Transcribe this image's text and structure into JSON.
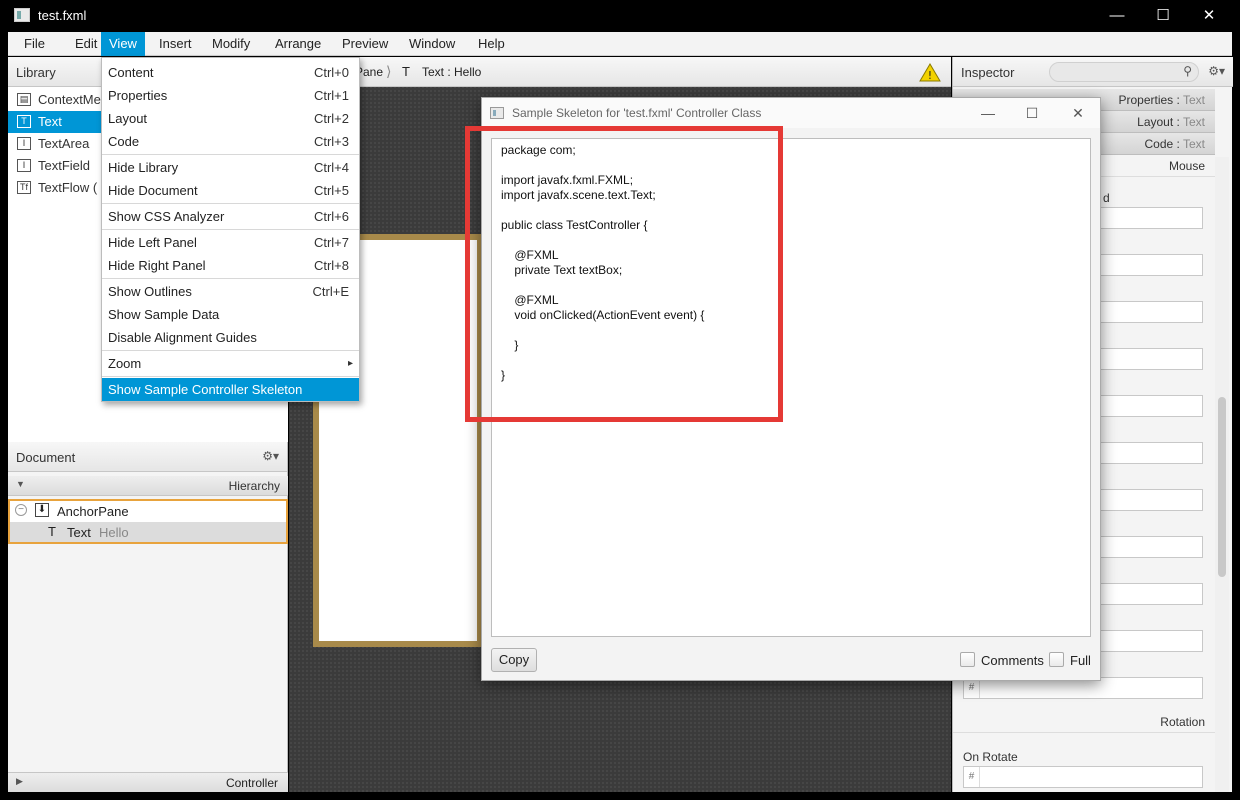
{
  "window": {
    "title": "test.fxml",
    "minimize_icon": "minimize-icon",
    "maximize_icon": "maximize-icon",
    "close_icon": "close-icon"
  },
  "menubar": {
    "items": [
      "File",
      "Edit",
      "View",
      "Insert",
      "Modify",
      "Arrange",
      "Preview",
      "Window",
      "Help"
    ],
    "active": "View"
  },
  "library": {
    "title": "Library",
    "items": [
      {
        "label": "ContextMe",
        "icon": "context-menu-icon"
      },
      {
        "label": "Text",
        "icon": "text-icon"
      },
      {
        "label": "TextArea",
        "icon": "textarea-icon"
      },
      {
        "label": "TextField",
        "icon": "textfield-icon"
      },
      {
        "label": "TextFlow  (",
        "icon": "textflow-icon"
      }
    ],
    "selected": "Text"
  },
  "document": {
    "title": "Document",
    "hierarchy_label": "Hierarchy",
    "tree": [
      {
        "label": "AnchorPane",
        "value": ""
      },
      {
        "label": "Text",
        "value": "Hello"
      }
    ],
    "controller_label": "Controller"
  },
  "breadcrumb": {
    "items": [
      "Pane",
      "Text : Hello"
    ]
  },
  "inspector": {
    "title": "Inspector",
    "sections": [
      {
        "label": "Properties",
        "sub": "Text"
      },
      {
        "label": "Layout",
        "sub": "Text"
      },
      {
        "label": "Code",
        "sub": "Text"
      }
    ],
    "mouse_label": "Mouse",
    "partial_label": "d",
    "rotation_label": "Rotation",
    "on_rotate_label": "On Rotate",
    "hash": "#"
  },
  "view_menu": {
    "items": [
      {
        "label": "Content",
        "shortcut": "Ctrl+0"
      },
      {
        "label": "Properties",
        "shortcut": "Ctrl+1"
      },
      {
        "label": "Layout",
        "shortcut": "Ctrl+2"
      },
      {
        "label": "Code",
        "shortcut": "Ctrl+3"
      },
      {
        "label": "Hide Library",
        "shortcut": "Ctrl+4"
      },
      {
        "label": "Hide Document",
        "shortcut": "Ctrl+5"
      },
      {
        "label": "Show CSS Analyzer",
        "shortcut": "Ctrl+6"
      },
      {
        "label": "Hide Left Panel",
        "shortcut": "Ctrl+7"
      },
      {
        "label": "Hide Right Panel",
        "shortcut": "Ctrl+8"
      },
      {
        "label": "Show Outlines",
        "shortcut": "Ctrl+E"
      },
      {
        "label": "Show Sample Data",
        "shortcut": ""
      },
      {
        "label": "Disable Alignment Guides",
        "shortcut": ""
      },
      {
        "label": "Zoom",
        "shortcut": ""
      },
      {
        "label": "Show Sample Controller Skeleton",
        "shortcut": ""
      }
    ],
    "selected": "Show Sample Controller Skeleton",
    "submenu_arrow": "▸"
  },
  "dialog": {
    "title": "Sample Skeleton for 'test.fxml' Controller Class",
    "code_lines": [
      "package com;",
      "",
      "import javafx.fxml.FXML;",
      "import javafx.scene.text.Text;",
      "",
      "public class TestController {",
      "",
      "    @FXML",
      "    private Text textBox;",
      "",
      "    @FXML",
      "    void onClicked(ActionEvent event) {",
      "",
      "    }",
      "",
      "}"
    ],
    "copy_label": "Copy",
    "comments_label": "Comments",
    "full_label": "Full",
    "comments_checked": false,
    "full_checked": false
  },
  "colors": {
    "accent": "#0096d6",
    "highlight_box": "#e53935",
    "selection_border": "#e8a33d",
    "canvas_frame": "#a88a4a",
    "warning": "#f2d200"
  }
}
